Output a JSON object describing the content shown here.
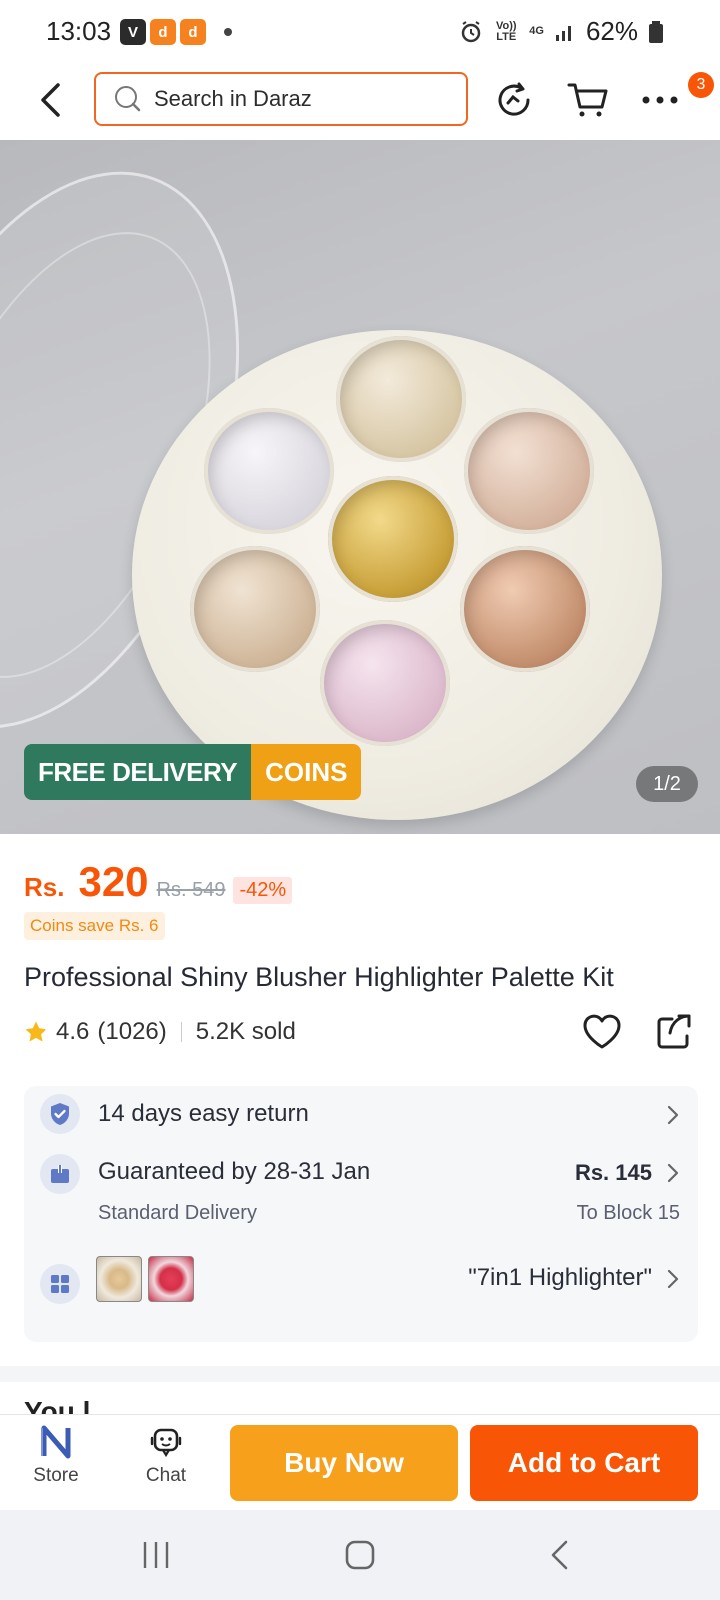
{
  "status_bar": {
    "time": "13:03",
    "battery": "62%",
    "volte": "Vo)) LTE",
    "network": "4G"
  },
  "header": {
    "search_placeholder": "Search in Daraz",
    "cart_badge": "3"
  },
  "hero": {
    "promo_free_delivery": "FREE DELIVERY",
    "promo_coins": "COINS",
    "image_counter": "1/2"
  },
  "product": {
    "currency": "Rs.",
    "price": "320",
    "old_price": "Rs. 549",
    "discount": "-42%",
    "coins_save": "Coins save Rs. 6",
    "title": "Professional Shiny Blusher Highlighter Palette Kit",
    "rating": "4.6",
    "reviews": "(1026)",
    "sold": "5.2K sold",
    "rating_fraction": 0.92
  },
  "info": {
    "return_text": "14 days easy return",
    "delivery_title": "Guaranteed by 28-31 Jan",
    "delivery_sub": "Standard Delivery",
    "delivery_price": "Rs. 145",
    "delivery_to": "To Block 15",
    "variant_label": "\"7in1 Highlighter\""
  },
  "peek": {
    "text": "You l"
  },
  "bottom_bar": {
    "store_label": "Store",
    "chat_label": "Chat",
    "buy_now": "Buy Now",
    "add_to_cart": "Add to Cart"
  },
  "colors": {
    "accent": "#f85606",
    "buy_now": "#f7a01c",
    "free_delivery": "#2f7a5f",
    "coins": "#f0a015"
  },
  "icons": [
    "back-icon",
    "search-icon",
    "refresh-icon",
    "cart-icon",
    "more-icon",
    "star-icon",
    "heart-icon",
    "share-icon",
    "shield-icon",
    "delivery-icon",
    "variants-icon",
    "chevron-right-icon",
    "store-icon",
    "chat-icon"
  ]
}
